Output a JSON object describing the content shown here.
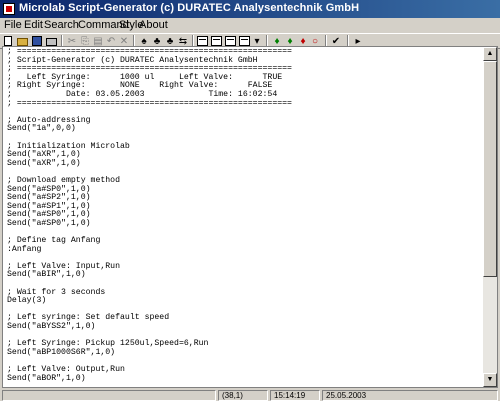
{
  "window": {
    "title": "Microlab Script-Generator (c) DURATEC Analysentechnik GmbH"
  },
  "menu": [
    "File",
    "Edit",
    "Search",
    "Command",
    "Style",
    "About"
  ],
  "toolbar": {
    "icons": [
      "new-file-icon",
      "open-folder-icon",
      "save-icon",
      "print-icon",
      "cut-icon",
      "copy-icon",
      "paste-icon",
      "undo-icon",
      "delete-icon",
      "binoculars-icon",
      "find-next-icon",
      "find-previous-icon",
      "replace-icon",
      "window-icon",
      "split-window-icon",
      "tile-window-icon",
      "cascade-icon",
      "dropdown-icon",
      "pipette-icon",
      "pipette-left-icon",
      "pipette-right-icon",
      "stop-icon",
      "check-icon",
      "run-icon"
    ],
    "glyphs": {
      "cut": "✂",
      "copy": "⎘",
      "paste": "▤",
      "undo": "↶",
      "delete": "✕",
      "binoculars": "♠",
      "find": "♣",
      "replace": "⇆",
      "check": "✔",
      "run": "▸",
      "stop": "○",
      "dropdown": "▾"
    }
  },
  "editor": {
    "lines": [
      "; ========================================================",
      "; Script-Generator (c) DURATEC Analysentechnik GmbH",
      "; ========================================================",
      ";   Left Syringe:      1000 ul     Left Valve:      TRUE",
      "; Right Syringe:       NONE    Right Valve:      FALSE",
      ";           Date: 03.05.2003             Time: 16:02:54",
      "; ========================================================",
      "",
      "; Auto-addressing",
      "Send(\"1a\",0,0)",
      "",
      "; Initialization Microlab",
      "Send(\"aXR\",1,0)",
      "Send(\"aXR\",1,0)",
      "",
      "; Download empty method",
      "Send(\"a#SP0\",1,0)",
      "Send(\"a#SP2\",1,0)",
      "Send(\"a#SP1\",1,0)",
      "Send(\"a#SP0\",1,0)",
      "Send(\"a#SP0\",1,0)",
      "",
      "; Define tag Anfang",
      ":Anfang",
      "",
      "; Left Valve: Input,Run",
      "Send(\"aBIR\",1,0)",
      "",
      "; Wait for 3 seconds",
      "Delay(3)",
      "",
      "; Left syringe: Set default speed",
      "Send(\"aBYSS2\",1,0)",
      "",
      "; Left Syringe: Pickup 1250ul,Speed=6,Run",
      "Send(\"aBP1000S6R\",1,0)",
      "",
      "; Left Valve: Output,Run",
      "Send(\"aBOR\",1,0)"
    ]
  },
  "scrollbar": {
    "up_arrow": "▲",
    "down_arrow": "▼"
  },
  "status": {
    "cursor": "(38,1)",
    "time": "15:14:19",
    "date": "25.05.2003"
  }
}
